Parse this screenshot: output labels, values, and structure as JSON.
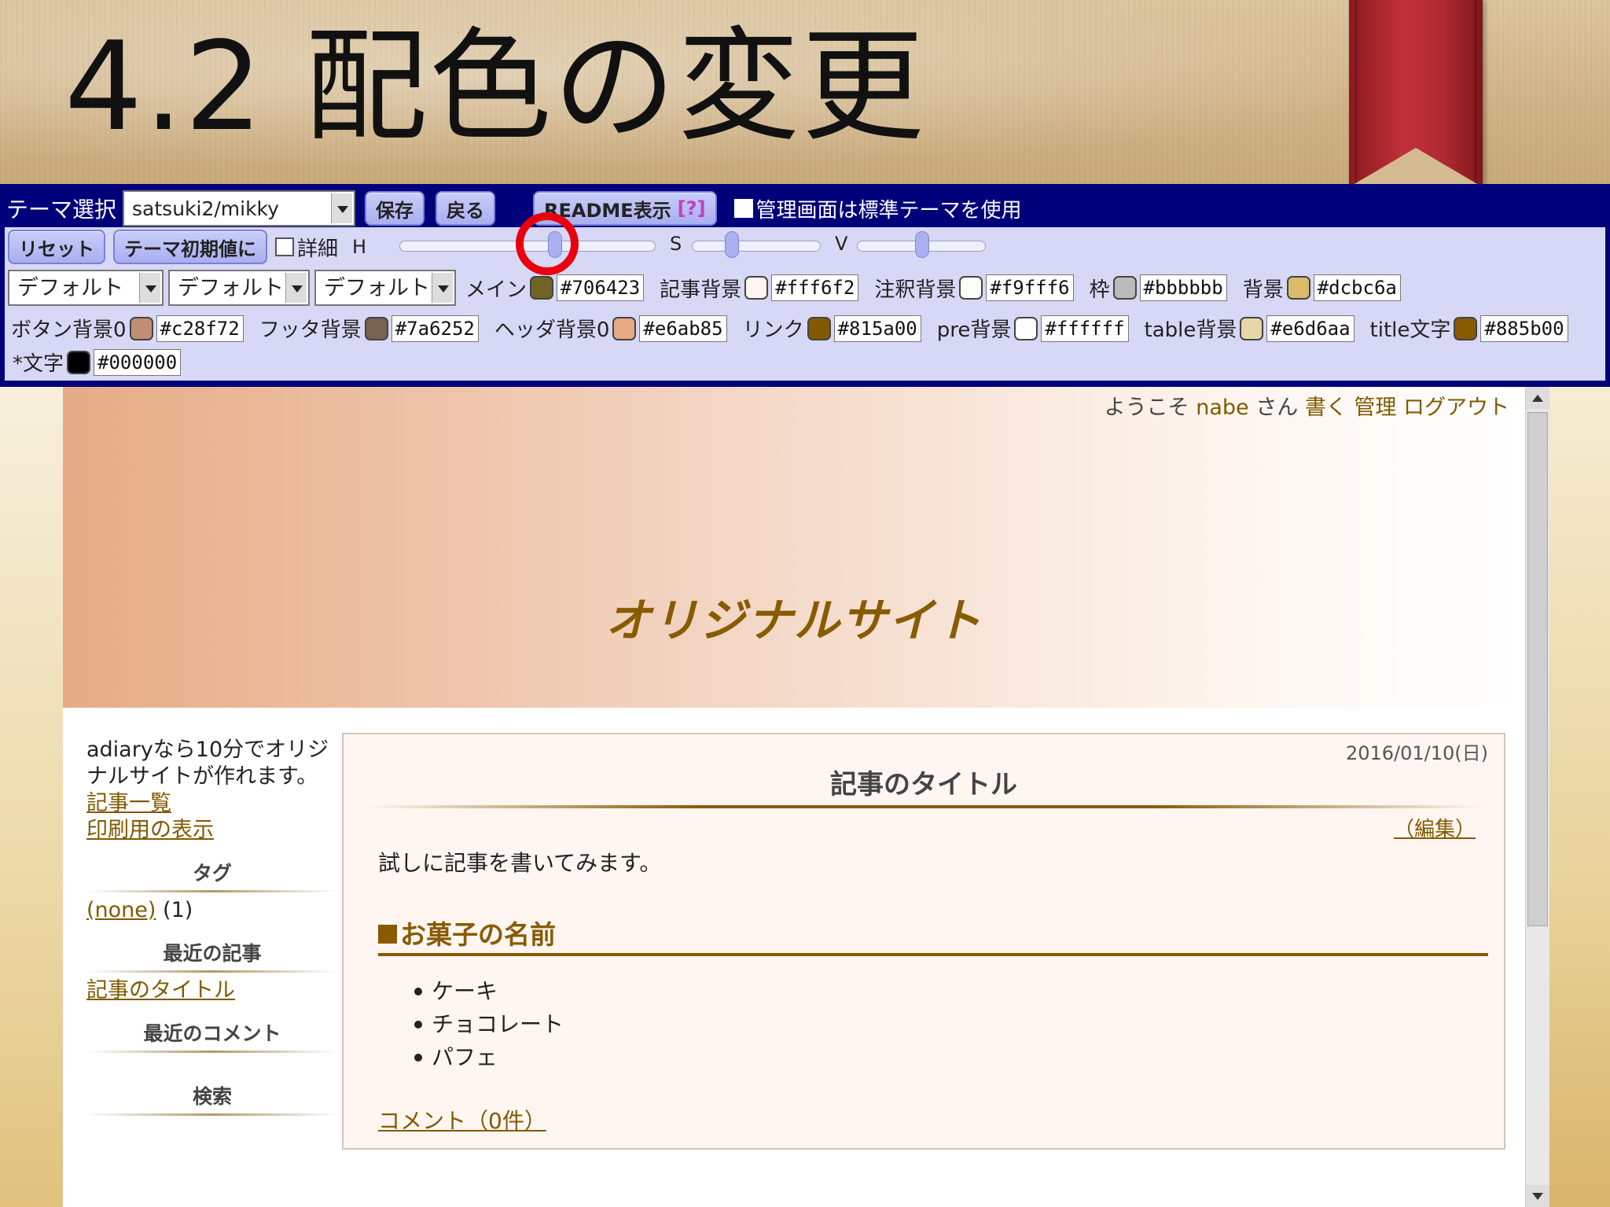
{
  "slide": {
    "title": "4.2 配色の変更"
  },
  "panel": {
    "theme_label": "テーマ選択",
    "theme_value": "satsuki2/mikky",
    "save": "保存",
    "back": "戻る",
    "readme": "README表示",
    "readme_q": "[?]",
    "admin_std": "管理画面は標準テーマを使用",
    "reset": "リセット",
    "theme_default": "テーマ初期値に",
    "detail": "詳細",
    "h": "H",
    "s": "S",
    "v": "V",
    "hsv_levels": {
      "h": 0.6,
      "s": 0.3,
      "v": 0.5
    },
    "selects": [
      "デフォルト",
      "デフォルト",
      "デフォルト"
    ],
    "colors_row1": [
      {
        "label": "メイン",
        "hex": "#706423",
        "color": "#706423"
      },
      {
        "label": "記事背景",
        "hex": "#fff6f2",
        "color": "#fff6f2"
      },
      {
        "label": "注釈背景",
        "hex": "#f9fff6",
        "color": "#f9fff6"
      },
      {
        "label": "枠",
        "hex": "#bbbbbb",
        "color": "#bbbbbb"
      },
      {
        "label": "背景",
        "hex": "#dcbc6a",
        "color": "#dcbc6a"
      }
    ],
    "colors_row2": [
      {
        "label": "ボタン背景0",
        "hex": "#c28f72",
        "color": "#c28f72"
      },
      {
        "label": "フッタ背景",
        "hex": "#7a6252",
        "color": "#7a6252"
      },
      {
        "label": "ヘッダ背景0",
        "hex": "#e6ab85",
        "color": "#e6ab85"
      },
      {
        "label": "リンク",
        "hex": "#815a00",
        "color": "#815a00"
      },
      {
        "label": "pre背景",
        "hex": "#ffffff",
        "color": "#ffffff"
      },
      {
        "label": "table背景",
        "hex": "#e6d6aa",
        "color": "#e6d6aa"
      },
      {
        "label": "title文字",
        "hex": "#885b00",
        "color": "#885b00"
      }
    ],
    "colors_row3": [
      {
        "label": "*文字",
        "hex": "#000000",
        "color": "#000000"
      }
    ]
  },
  "blog": {
    "welcome": "ようこそ",
    "user": "nabe",
    "san": "さん",
    "write": "書く",
    "admin": "管理",
    "logout": "ログアウト",
    "site_title": "オリジナルサイト",
    "sidebar_text": "adiaryなら10分でオリジナルサイトが作れます。",
    "link_list": "記事一覧",
    "link_print": "印刷用の表示",
    "tag_head": "タグ",
    "tag_none": "(none)",
    "tag_count": "(1)",
    "recent_head": "最近の記事",
    "recent_link": "記事のタイトル",
    "comment_head": "最近のコメント",
    "search_head": "検索",
    "article": {
      "date": "2016/01/10(日)",
      "title": "記事のタイトル",
      "edit": "（編集）",
      "body": "試しに記事を書いてみます。",
      "h3": "お菓子の名前",
      "items": [
        "ケーキ",
        "チョコレート",
        "パフェ"
      ],
      "comment": "コメント（0件）"
    }
  }
}
